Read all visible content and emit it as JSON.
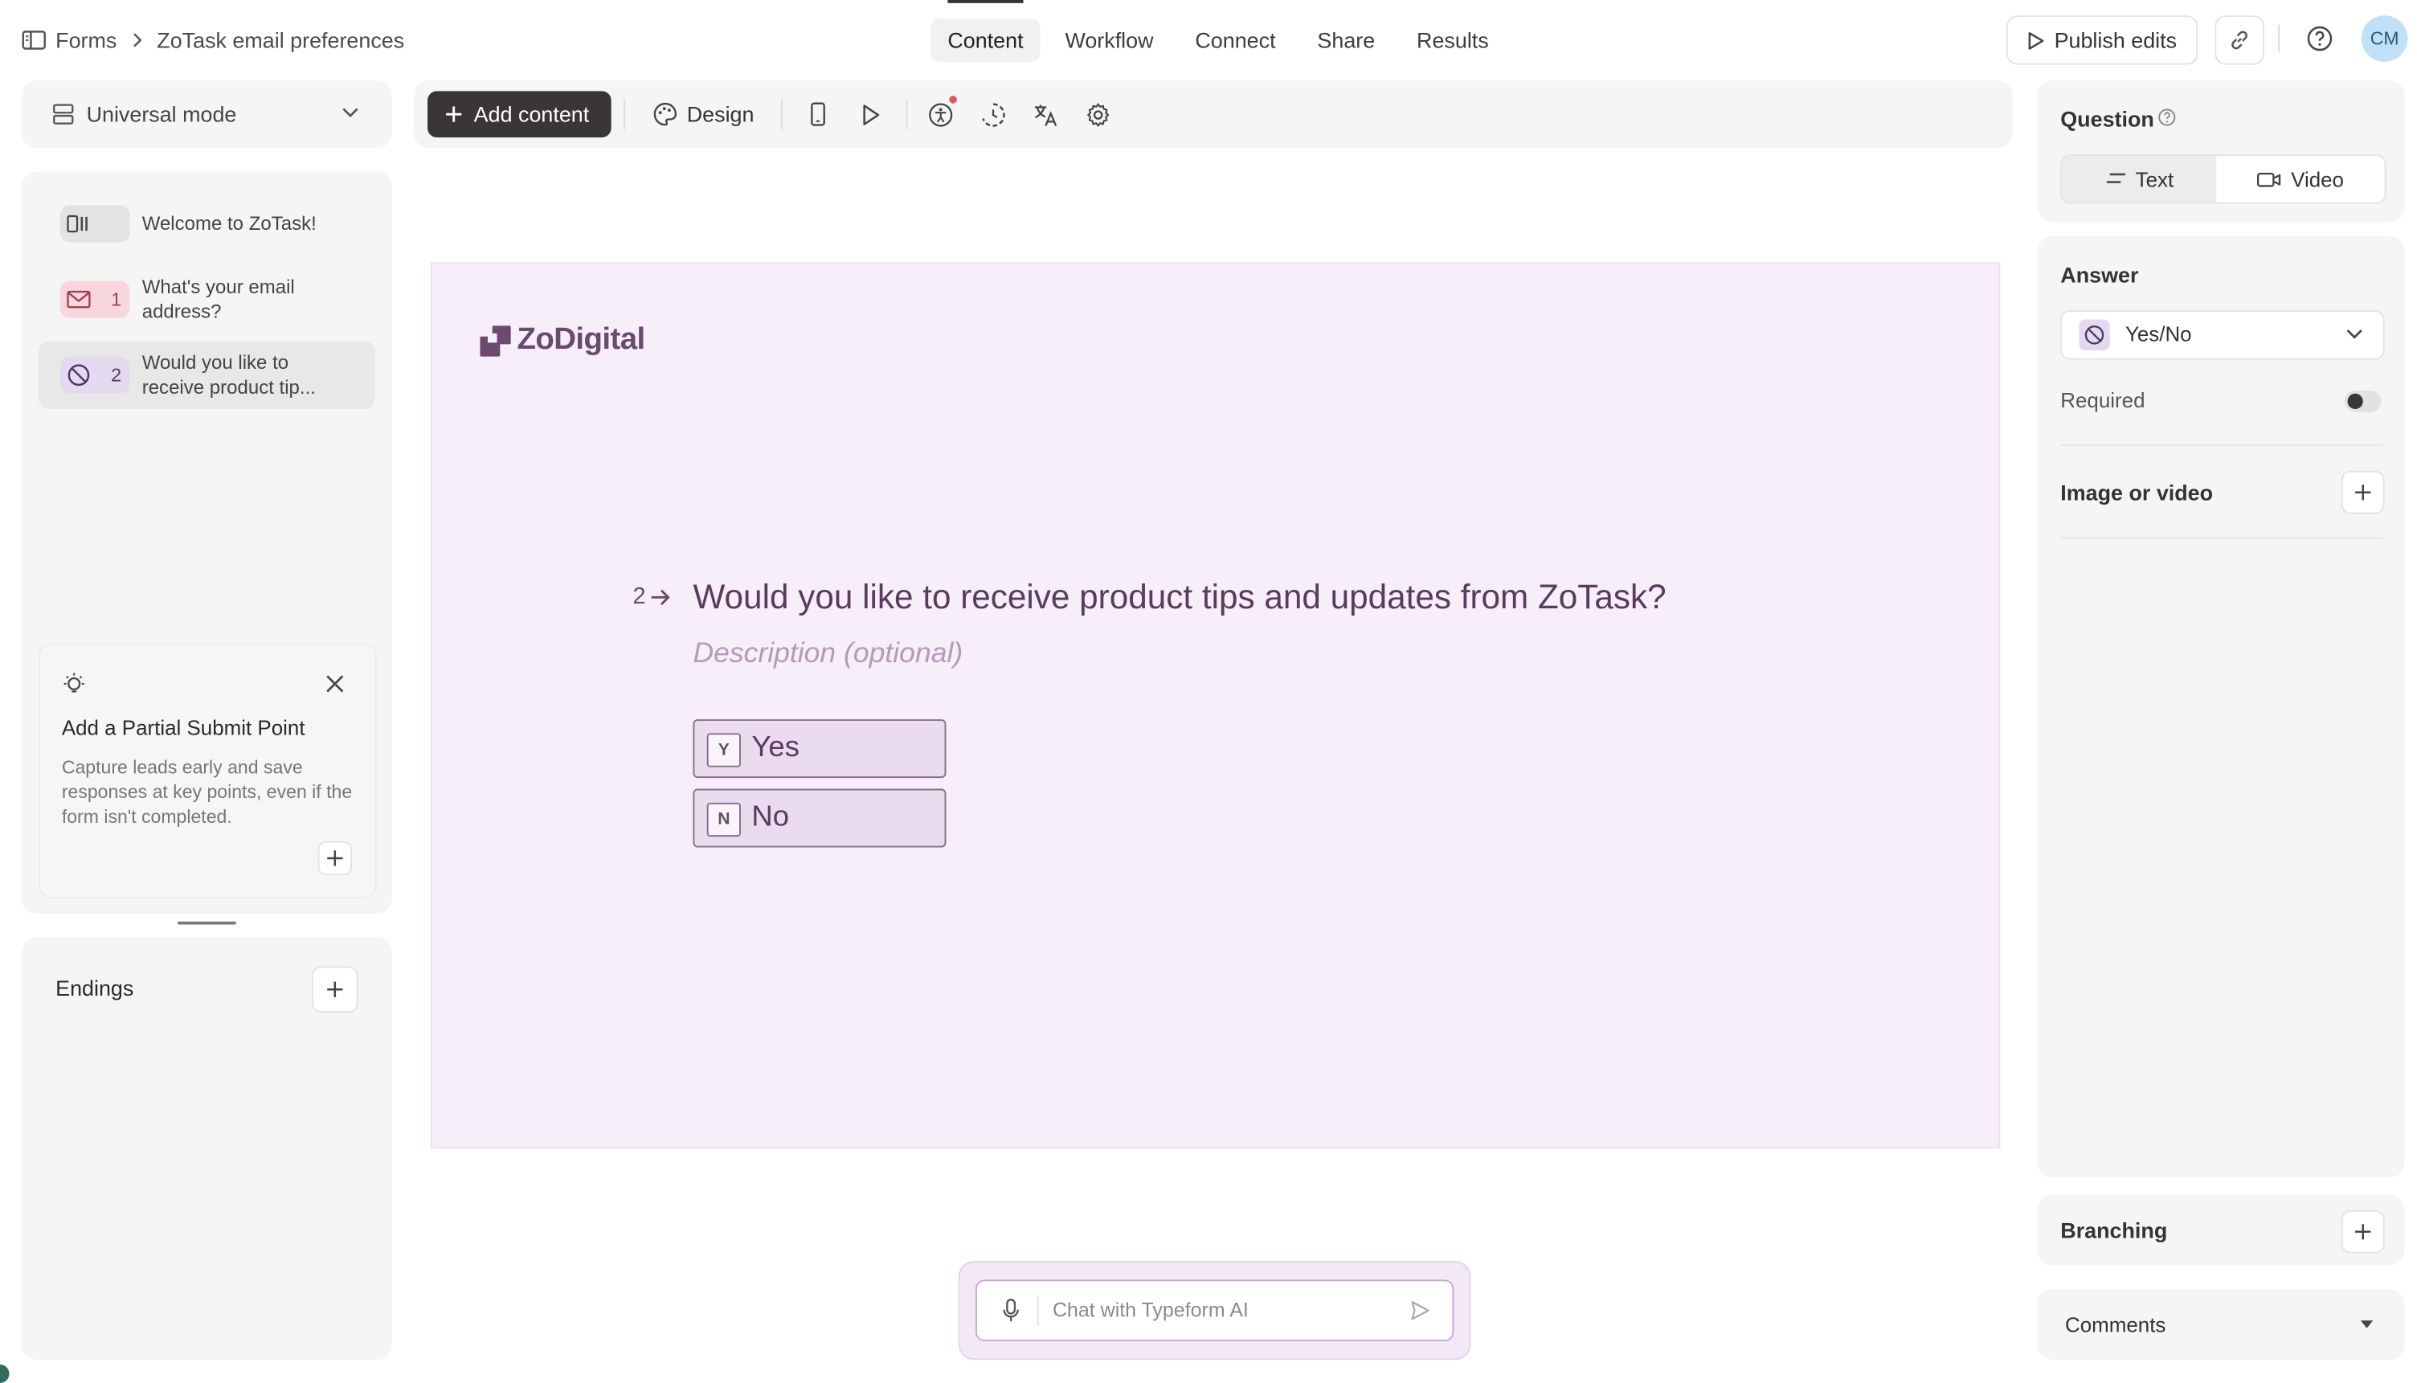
{
  "breadcrumb": {
    "root": "Forms",
    "form_name": "ZoTask email preferences"
  },
  "nav_tabs": [
    "Content",
    "Workflow",
    "Connect",
    "Share",
    "Results"
  ],
  "header": {
    "publish_label": "Publish edits",
    "avatar_initials": "CM"
  },
  "left_panel": {
    "mode_label": "Universal mode",
    "items": [
      {
        "number": "",
        "label": "Welcome to ZoTask!",
        "icon": "welcome-screen-icon"
      },
      {
        "number": "1",
        "label": "What's your email address?",
        "icon": "envelope-icon"
      },
      {
        "number": "2",
        "label": "Would you like to receive product tip...",
        "icon": "yes-no-icon"
      }
    ],
    "tip": {
      "title": "Add a Partial Submit Point",
      "body": "Capture leads early and save responses at key points, even if the form isn't completed."
    },
    "endings_label": "Endings"
  },
  "toolbar": {
    "add_content_label": "Add content",
    "design_label": "Design"
  },
  "canvas": {
    "brand": "ZoDigital",
    "question_number": "2",
    "question": "Would you like to receive product tips and updates from ZoTask?",
    "description_placeholder": "Description (optional)",
    "choices": [
      {
        "key": "Y",
        "label": "Yes"
      },
      {
        "key": "N",
        "label": "No"
      }
    ]
  },
  "ai_chat": {
    "placeholder": "Chat with Typeform AI"
  },
  "right_panel": {
    "question_label": "Question",
    "question_types": [
      "Text",
      "Video"
    ],
    "answer_label": "Answer",
    "answer_type": "Yes/No",
    "required_label": "Required",
    "image_label": "Image or video",
    "branching_label": "Branching",
    "comments_label": "Comments"
  },
  "colors": {
    "canvas_bg": "#f6eef8",
    "brand": "#6b4a6f",
    "primary_button": "#3a3538",
    "accent_red": "#e05560",
    "avatar_bg": "#bfe0f7"
  }
}
